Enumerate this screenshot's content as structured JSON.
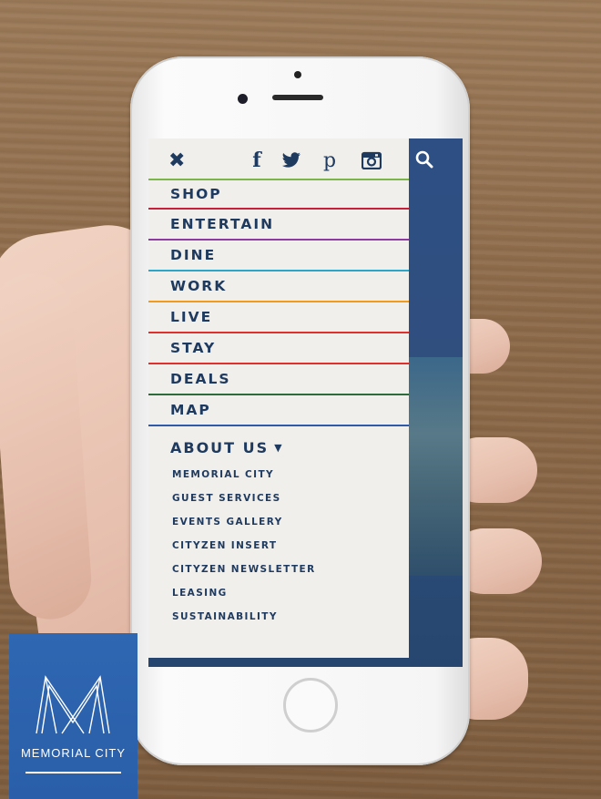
{
  "menu": {
    "items": [
      {
        "label": "SHOP",
        "color": "#7ab648"
      },
      {
        "label": "ENTERTAIN",
        "color": "#c8203a"
      },
      {
        "label": "DINE",
        "color": "#8d3b9e"
      },
      {
        "label": "WORK",
        "color": "#2aa6c8"
      },
      {
        "label": "LIVE",
        "color": "#f29a1c"
      },
      {
        "label": "STAY",
        "color": "#e0302e"
      },
      {
        "label": "DEALS",
        "color": "#e0302e"
      },
      {
        "label": "MAP",
        "color": "#2e6b3a"
      }
    ],
    "about_label": "ABOUT US",
    "about_caret": "▼",
    "about_items": [
      "MEMORIAL CITY",
      "GUEST SERVICES",
      "EVENTS GALLERY",
      "CITYZEN INSERT",
      "CITYZEN NEWSLETTER",
      "LEASING",
      "SUSTAINABILITY"
    ],
    "map_divider_color": "#2f5aa8"
  },
  "top_bar": {
    "close_glyph": "✖",
    "facebook_glyph": "f",
    "pinterest_glyph": "p",
    "icons": [
      "close-icon",
      "facebook-icon",
      "twitter-icon",
      "pinterest-icon",
      "instagram-icon",
      "search-icon"
    ]
  },
  "brand": {
    "logo_text": "MEMORIAL CITY",
    "color": "#2f67b2"
  },
  "colors": {
    "navy": "#1e3a5f",
    "drawer_bg": "#f1efec",
    "screen_blue": "#2d4f84"
  }
}
